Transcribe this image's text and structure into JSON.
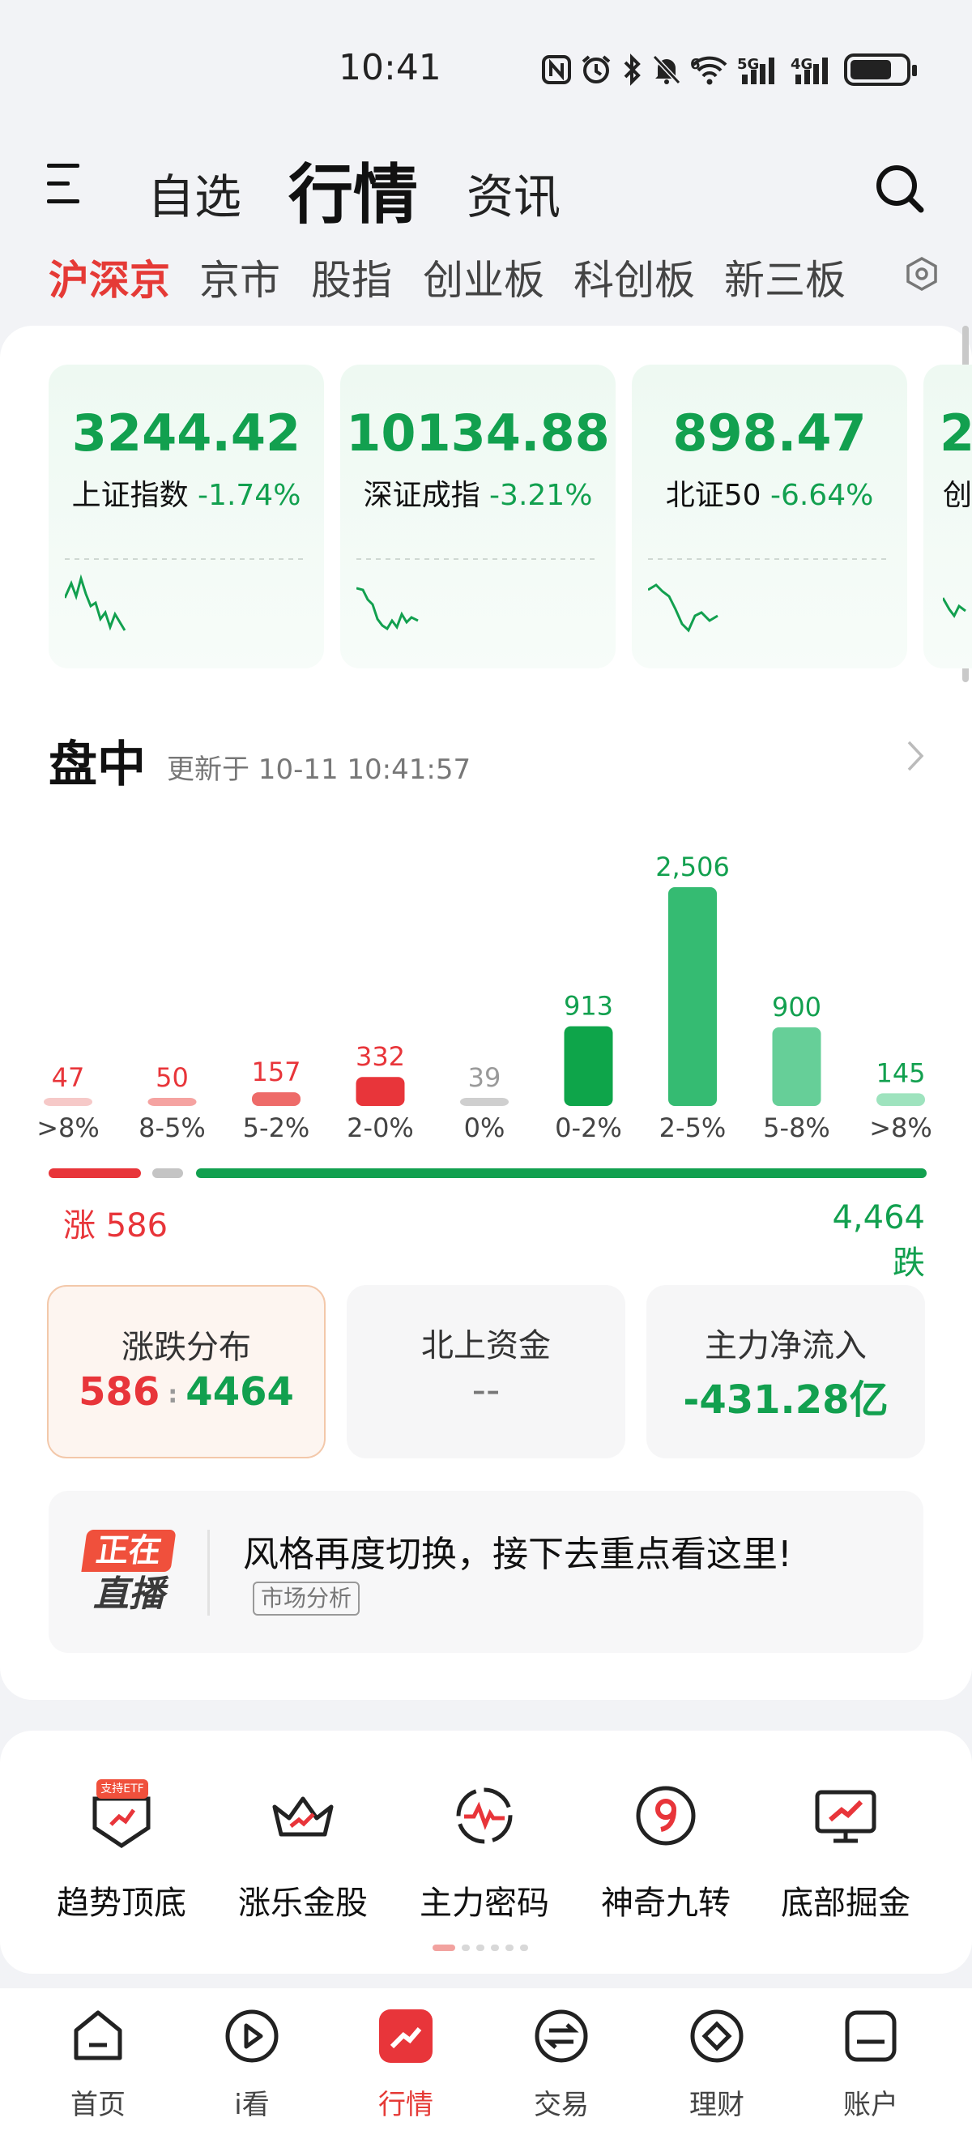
{
  "status_bar": {
    "time": "10:41",
    "icons": [
      "nfc-icon",
      "alarm-icon",
      "bluetooth-icon",
      "mute-icon",
      "wifi-6-icon",
      "signal-5g-icon",
      "signal-4g-icon",
      "battery-icon"
    ],
    "signal_5g": "5G",
    "signal_4g": "4G",
    "wifi_tag": "6"
  },
  "header": {
    "tabs": [
      {
        "label": "自选"
      },
      {
        "label": "行情"
      },
      {
        "label": "资讯"
      }
    ],
    "active_tab": "行情"
  },
  "sub_tabs": {
    "items": [
      {
        "label": "沪深京"
      },
      {
        "label": "京市"
      },
      {
        "label": "股指"
      },
      {
        "label": "创业板"
      },
      {
        "label": "科创板"
      },
      {
        "label": "新三板"
      }
    ],
    "active": "沪深京"
  },
  "indices": [
    {
      "value": "3244.42",
      "name": "上证指数",
      "change": "-1.74%"
    },
    {
      "value": "10134.88",
      "name": "深证成指",
      "change": "-3.21%"
    },
    {
      "value": "898.47",
      "name": "北证50",
      "change": "-6.64%"
    },
    {
      "value": "2",
      "name": "创",
      "change": ""
    }
  ],
  "intraday": {
    "title": "盘中",
    "updated": "更新于 10-11 10:41:57",
    "up_label": "涨 586",
    "down_label": "4,464 跌"
  },
  "chart_data": {
    "type": "bar",
    "categories": [
      ">8%",
      "8-5%",
      "5-2%",
      "2-0%",
      "0%",
      "0-2%",
      "2-5%",
      "5-8%",
      ">8%"
    ],
    "values": [
      47,
      50,
      157,
      332,
      39,
      913,
      2506,
      900,
      145
    ],
    "value_labels": [
      "47",
      "50",
      "157",
      "332",
      "39",
      "913",
      "2,506",
      "900",
      "145"
    ],
    "colors": [
      "#f6c9c8",
      "#f5a3a1",
      "#ee6b69",
      "#e8353a",
      "#cfcfcf",
      "#0ea54a",
      "#35bb72",
      "#66cf98",
      "#9ee3be"
    ],
    "label_colors": [
      "#e8353a",
      "#e8353a",
      "#e8353a",
      "#e8353a",
      "#9a9a9a",
      "#12a04f",
      "#12a04f",
      "#12a04f",
      "#12a04f"
    ],
    "title": "",
    "xlabel": "",
    "ylabel": "",
    "ylim": [
      0,
      2506
    ],
    "grid": false
  },
  "summary_tiles": [
    {
      "title": "涨跌分布",
      "up": "586",
      "down": "4464"
    },
    {
      "title": "北上资金",
      "value": "--"
    },
    {
      "title": "主力净流入",
      "value": "-431.28亿"
    }
  ],
  "live": {
    "badge_top": "正在",
    "badge_bottom": "直播",
    "headline": "风格再度切换，接下去重点看这里!",
    "tag": "市场分析"
  },
  "tools": [
    {
      "label": "趋势顶底",
      "icon": "shield-chart-icon",
      "badge": "支持ETF"
    },
    {
      "label": "涨乐金股",
      "icon": "crown-icon"
    },
    {
      "label": "主力密码",
      "icon": "pulse-icon"
    },
    {
      "label": "神奇九转",
      "icon": "nine-icon"
    },
    {
      "label": "底部掘金",
      "icon": "monitor-trend-icon"
    }
  ],
  "bottom_nav": [
    {
      "label": "首页",
      "icon": "home-icon"
    },
    {
      "label": "i看",
      "icon": "play-icon"
    },
    {
      "label": "行情",
      "icon": "market-icon"
    },
    {
      "label": "交易",
      "icon": "exchange-icon"
    },
    {
      "label": "理财",
      "icon": "finance-icon"
    },
    {
      "label": "账户",
      "icon": "account-icon"
    }
  ],
  "colors": {
    "red": "#e53a36",
    "green": "#12a04f",
    "accent": "#e53a36"
  }
}
